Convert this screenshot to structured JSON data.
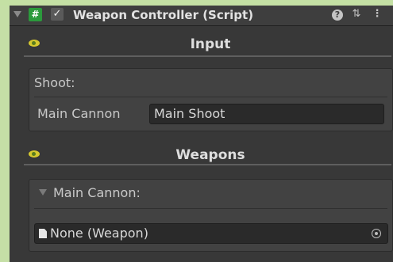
{
  "component": {
    "title": "Weapon Controller (Script)",
    "script_icon_glyph": "#",
    "enabled_checkmark": "✓",
    "help_glyph": "?",
    "presets_glyph": "⇅",
    "menu_glyph": "⋮",
    "enabled": true
  },
  "sections": {
    "input": {
      "title": "Input",
      "group_label": "Shoot:",
      "field_label": "Main Cannon",
      "field_value": "Main Shoot"
    },
    "weapons": {
      "title": "Weapons",
      "foldout_label": "Main Cannon:",
      "object_field_value": "None (Weapon)"
    }
  },
  "colors": {
    "accent_green": "#c4e0a4",
    "script_icon": "#2b9a3c",
    "eye_icon": "#d6c92e",
    "background": "#383838"
  },
  "icons": [
    "foldout-arrow-icon",
    "script-icon",
    "checkbox-icon",
    "help-icon",
    "presets-icon",
    "menu-icon",
    "eye-icon",
    "document-icon",
    "object-picker-icon"
  ]
}
